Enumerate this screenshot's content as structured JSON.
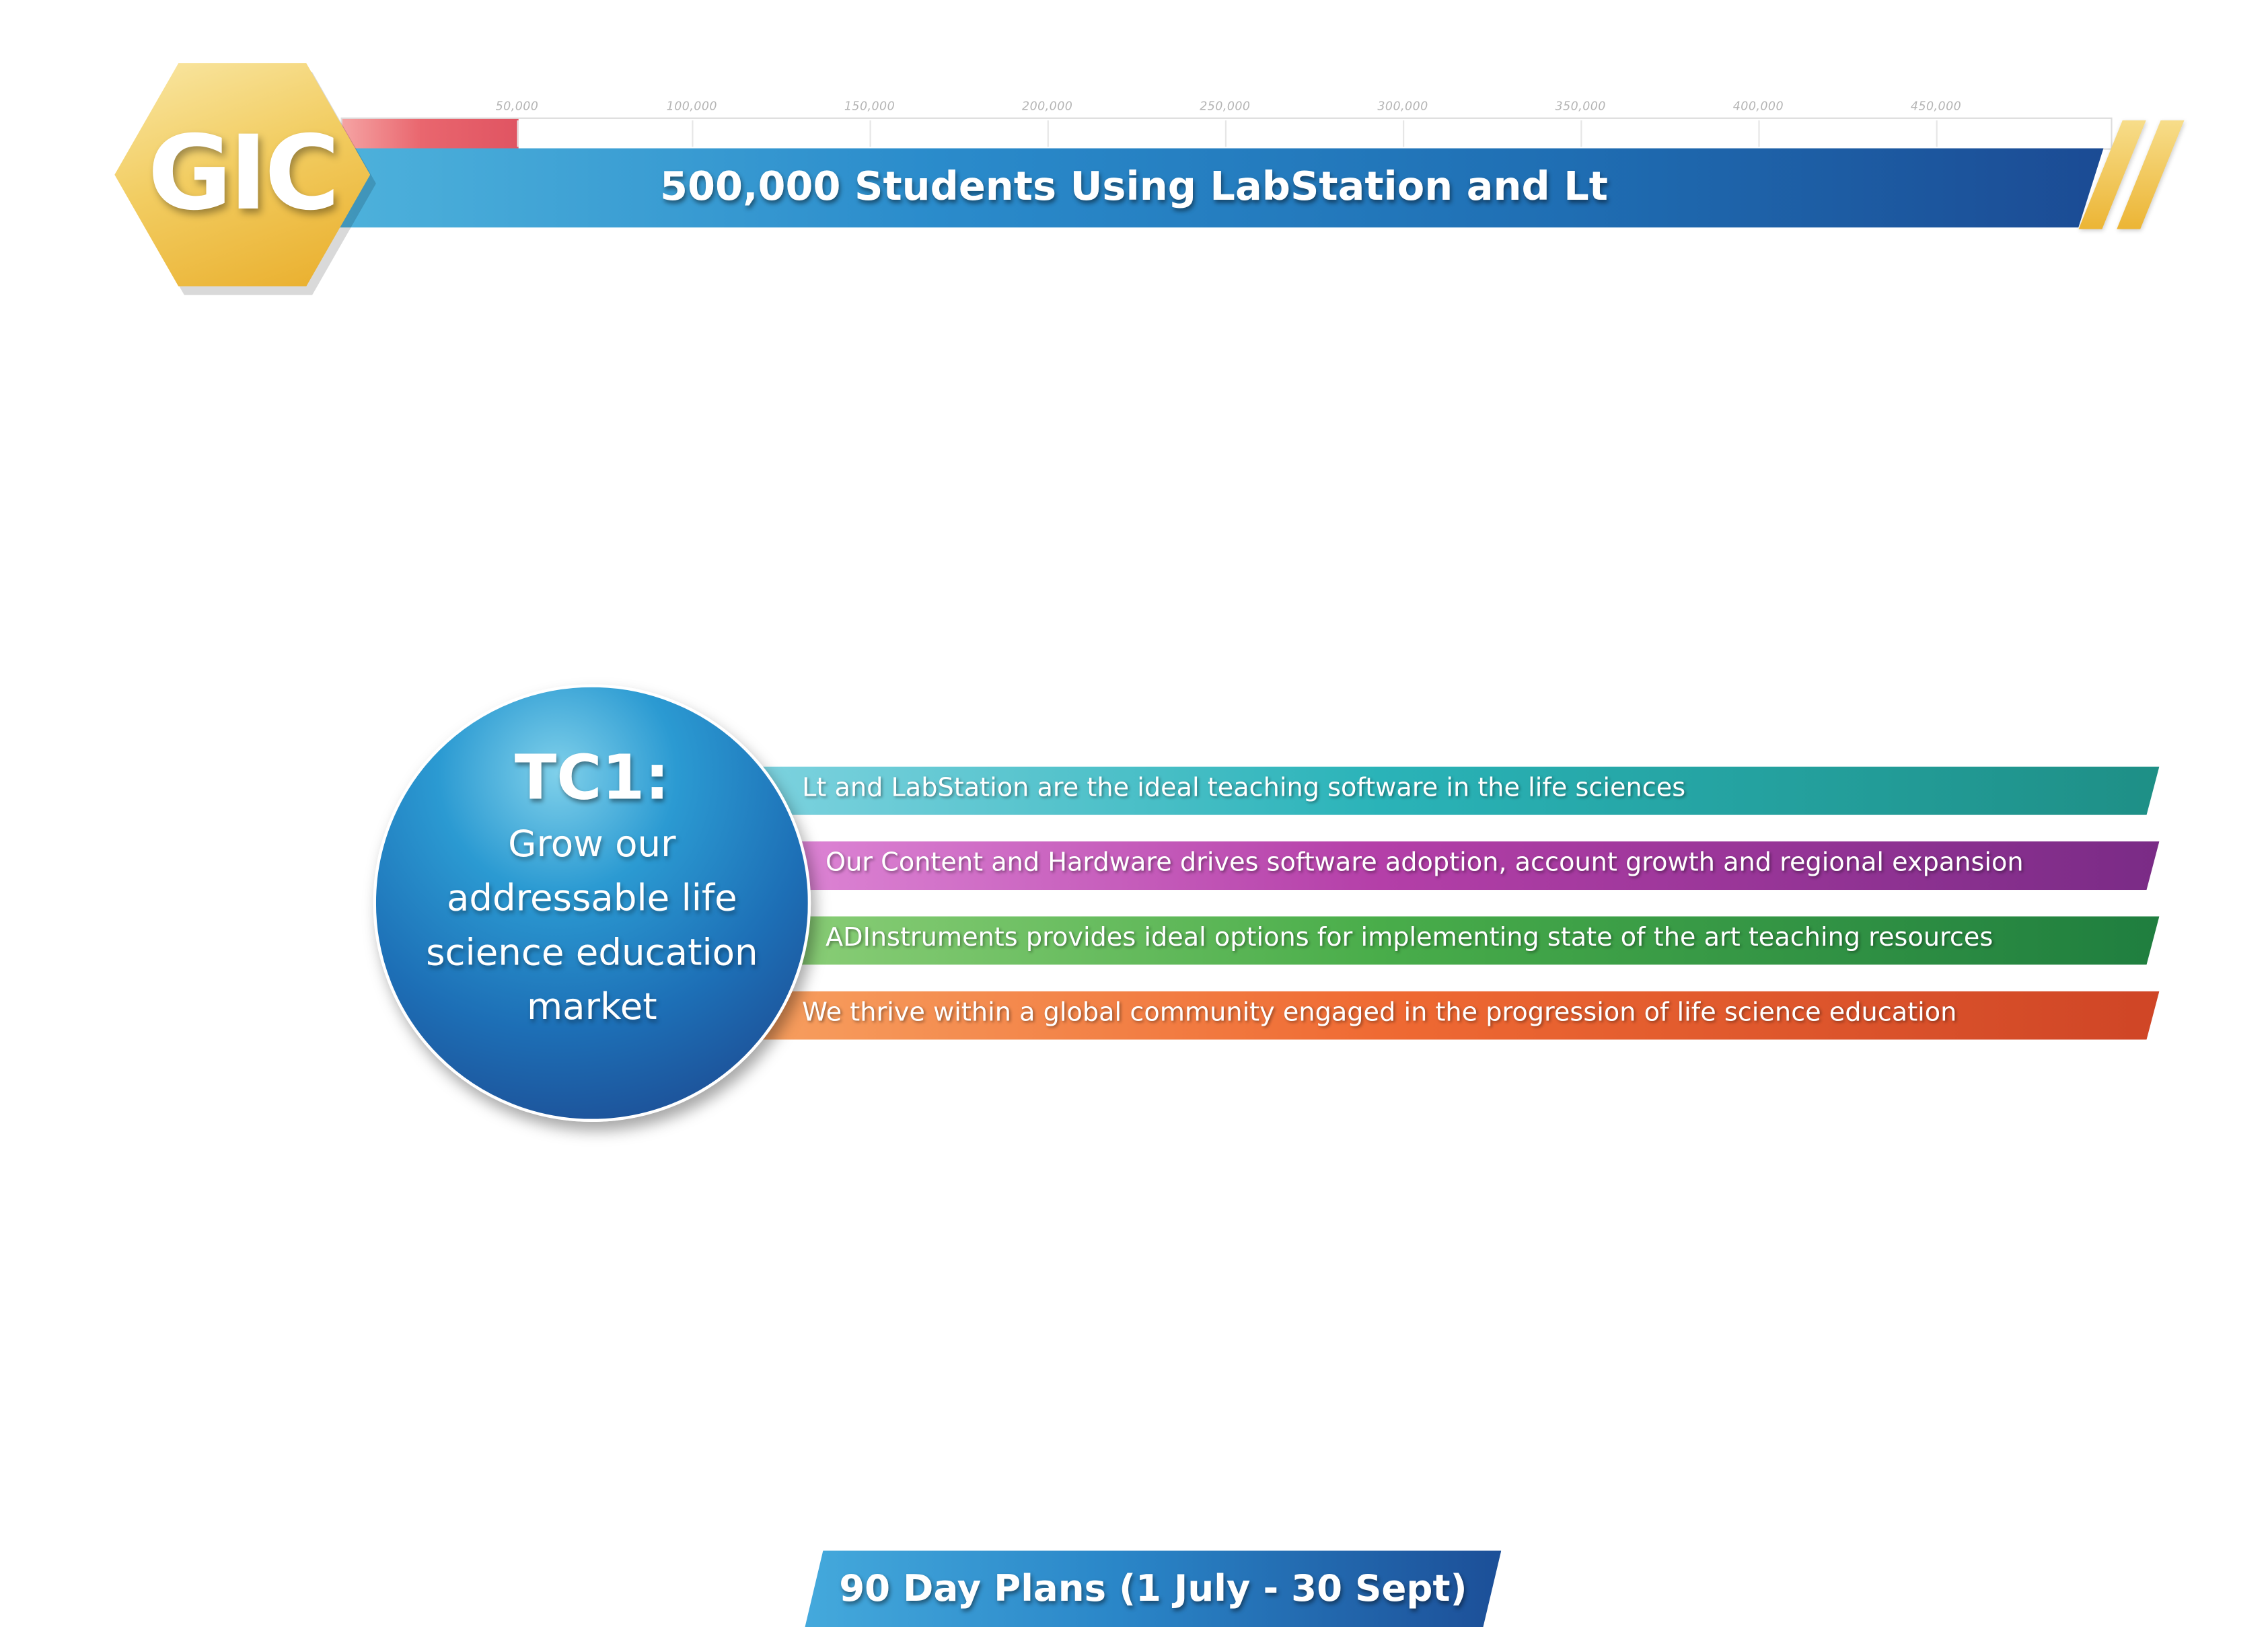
{
  "logo": {
    "text": "GIC"
  },
  "goal": {
    "title": "500,000 Students Using LabStation and Lt",
    "progress": {
      "value": 50000,
      "max": 500000
    },
    "scale_ticks": [
      "50,000",
      "100,000",
      "150,000",
      "200,000",
      "250,000",
      "300,000",
      "350,000",
      "400,000",
      "450,000"
    ]
  },
  "theme": {
    "title": "TC1:",
    "description": "Grow our addressable life science education market"
  },
  "pillars": [
    {
      "text": "Lt and LabStation are the ideal teaching software in the life sciences",
      "color": "#2ab3b8"
    },
    {
      "text": "Our Content and Hardware drives software adoption, account growth and regional expansion",
      "color": "#b43fa8"
    },
    {
      "text": "ADInstruments provides ideal options for implementing state of the art teaching resources",
      "color": "#49ad4a"
    },
    {
      "text": "We thrive within a global community engaged in the progression of life science education",
      "color": "#ef6a33"
    }
  ],
  "footer": {
    "label": "90 Day Plans (1 July - 30 Sept)"
  },
  "colors": {
    "brand_gold": "#f2cd62",
    "brand_blue": "#1f6eb3",
    "progress_red": "#e05462"
  }
}
